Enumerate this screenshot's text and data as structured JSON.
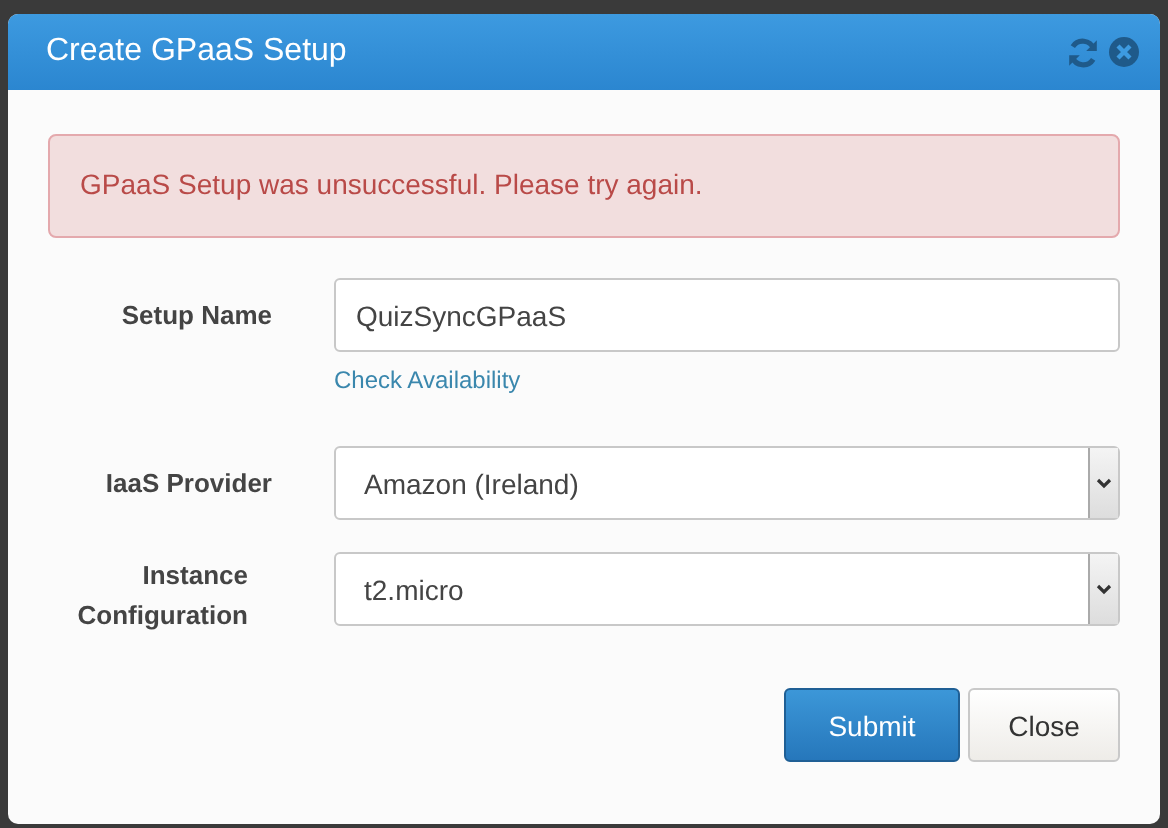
{
  "dialog": {
    "title": "Create GPaaS Setup"
  },
  "alert": {
    "message": "GPaaS Setup was unsuccessful. Please try again."
  },
  "fields": [
    {
      "kind": "text",
      "label": "Setup Name",
      "value": "QuizSyncGPaaS",
      "link": "Check Availability"
    },
    {
      "kind": "select",
      "label": "IaaS Provider",
      "value": "Amazon (Ireland)"
    },
    {
      "kind": "select",
      "label": "Instance Configuration",
      "value": "t2.micro"
    }
  ],
  "buttons": [
    {
      "kind": "primary",
      "label": "Submit"
    },
    {
      "kind": "default",
      "label": "Close"
    }
  ]
}
